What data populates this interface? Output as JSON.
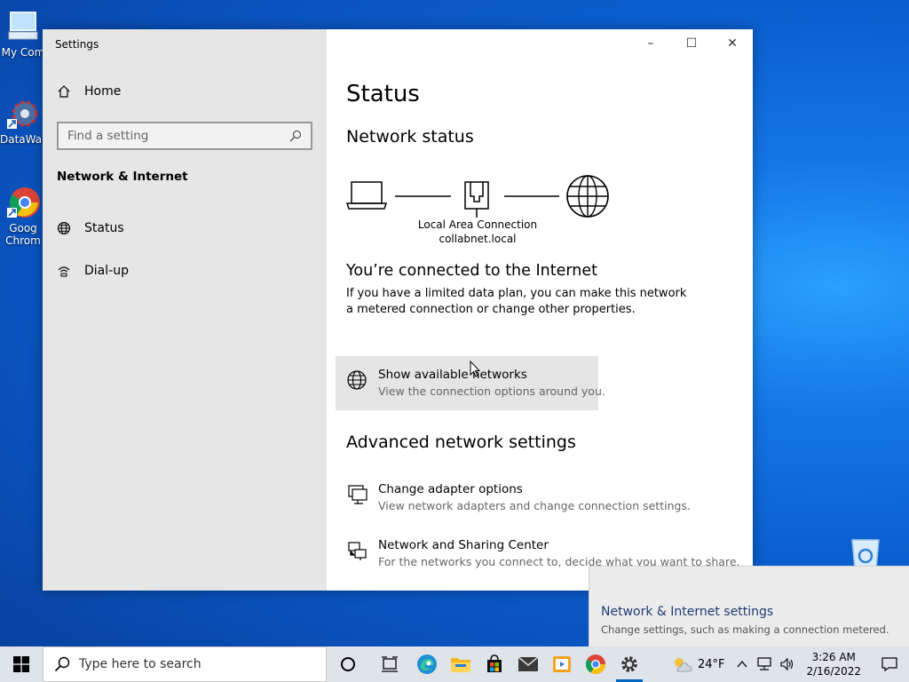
{
  "desktop": {
    "icons": [
      {
        "label": "My Com"
      },
      {
        "label": "DataWag"
      },
      {
        "label": "Goog Chrom"
      }
    ]
  },
  "window": {
    "title": "Settings",
    "controls": {
      "minimize": "–",
      "maximize": "☐",
      "close": "✕"
    }
  },
  "sidebar": {
    "home_label": "Home",
    "search_placeholder": "Find a setting",
    "section_title": "Network & Internet",
    "items": [
      {
        "label": "Status"
      },
      {
        "label": "Dial-up"
      }
    ]
  },
  "main": {
    "page_title": "Status",
    "network_status_heading": "Network status",
    "adapter_name": "Local Area Connection",
    "adapter_domain": "collabnet.local",
    "connected_heading": "You’re connected to the Internet",
    "connected_text": "If you have a limited data plan, you can make this network a metered connection or change other properties.",
    "show_networks": {
      "title": "Show available networks",
      "subtitle": "View the connection options around you."
    },
    "advanced_heading": "Advanced network settings",
    "advanced_items": [
      {
        "title": "Change adapter options",
        "subtitle": "View network adapters and change connection settings."
      },
      {
        "title": "Network and Sharing Center",
        "subtitle": "For the networks you connect to, decide what you want to share."
      }
    ]
  },
  "toast": {
    "title": "Network & Internet settings",
    "subtitle": "Change settings, such as making a connection metered."
  },
  "taskbar": {
    "search_placeholder": "Type here to search",
    "apps": [
      "task-view-icon",
      "edge-icon",
      "file-explorer-icon",
      "store-icon",
      "mail-icon",
      "media-icon",
      "chrome-icon",
      "settings-icon"
    ],
    "weather": "24°F",
    "time": "3:26 AM",
    "date": "2/16/2022"
  },
  "colors": {
    "accent": "#0067c0",
    "sidebar_bg": "#e6e6e6",
    "hover_bg": "#e5e5e5",
    "desktop": "#0b5fd0"
  }
}
